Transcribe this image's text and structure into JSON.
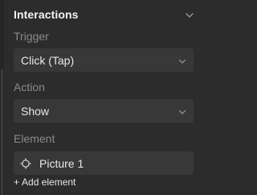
{
  "panel": {
    "title": "Interactions",
    "trigger": {
      "label": "Trigger",
      "value": "Click (Tap)"
    },
    "action": {
      "label": "Action",
      "value": "Show"
    },
    "element": {
      "label": "Element",
      "value": "Picture 1",
      "add_label": "Add element",
      "add_icon": "+"
    }
  },
  "icons": {
    "collapse": "chevron-down-icon",
    "select": "chevron-down-icon",
    "target": "crosshair-icon"
  },
  "colors": {
    "background": "#2c2c2c",
    "field": "#383838",
    "label": "#8a8a8a",
    "text": "#e8e8e8"
  }
}
